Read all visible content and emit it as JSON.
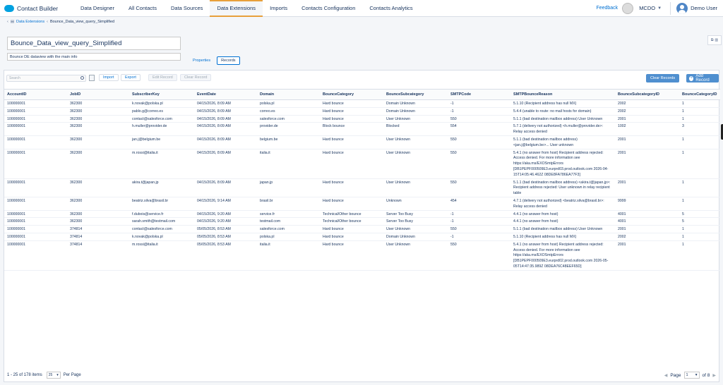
{
  "topbar": {
    "app_name": "Contact Builder",
    "nav": [
      "Data Designer",
      "All Contacts",
      "Data Sources",
      "Data Extensions",
      "Imports",
      "Contacts Configuration",
      "Contacts Analytics"
    ],
    "active_nav": "Data Extensions",
    "feedback": "Feedback",
    "business_unit": "MCDO",
    "user_name": "Demo User"
  },
  "breadcrumb": {
    "parent": "Data Extensions",
    "current": "Bounce_Data_view_query_Simplified"
  },
  "extension": {
    "name": "Bounce_Data_view_query_Simplified",
    "description": "Bounce DE dataview with the main info"
  },
  "tabs": [
    "Properties",
    "Records"
  ],
  "active_tab": "Records",
  "toolbar": {
    "search_placeholder": "Search",
    "import": "Import",
    "export": "Export",
    "edit_record": "Edit Record",
    "clear_record": "Clear Record",
    "clear_records": "Clear Records",
    "add_record": "Add Record"
  },
  "table": {
    "columns": [
      "AccountID",
      "JobID",
      "SubscriberKey",
      "EventDate",
      "Domain",
      "BounceCategory",
      "BounceSubcategory",
      "SMTPCode",
      "SMTPBounceReason",
      "BounceSubcategoryID",
      "BounceCategoryID"
    ],
    "rows": [
      [
        "100000001",
        "362300",
        "k.novak@polska.pl",
        "04/15/2026, 8:09 AM",
        "polska.pl",
        "Hard bounce",
        "Domain Unknown",
        "-1",
        "5.1.10 (Recipient address has null MX)",
        "2002",
        "1"
      ],
      [
        "100000001",
        "362300",
        "pablo.g@correo.es",
        "04/15/2026, 8:09 AM",
        "correo.es",
        "Hard bounce",
        "Domain Unknown",
        "-1",
        "5.4.4 (unable to route: no mail hosts for domain)",
        "2002",
        "1"
      ],
      [
        "100000001",
        "362300",
        "contact@salesforce.com",
        "04/15/2026, 8:09 AM",
        "salesforce.com",
        "Hard bounce",
        "User Unknown",
        "550",
        "5.1.1 (bad destination mailbox address) User Unknown",
        "2001",
        "1"
      ],
      [
        "100000001",
        "362300",
        "h.muller@provider.de",
        "04/15/2026, 8:09 AM",
        "provider.de",
        "Block bounce",
        "Blocked",
        "554",
        "5.7.1 (delivery not authorized) <h.muller@provider.de>: Relay access denied",
        "1002",
        "3"
      ],
      [
        "100000001",
        "362300",
        "jan.j@belgium.be",
        "04/15/2026, 8:09 AM",
        "belgium.be",
        "Hard bounce",
        "User Unknown",
        "550",
        "5.1.1 (bad destination mailbox address) <jan.j@belgium.be>... User unknown",
        "2001",
        "1"
      ],
      [
        "100000001",
        "362300",
        "m.rossi@italia.it",
        "04/15/2026, 8:09 AM",
        "italia.it",
        "Hard bounce",
        "User Unknown",
        "550",
        "5.4.1 (no answer from host) Recipient address rejected: Access denied. For more information see https://aka.ms/EXOSmtpErrors [DB1PEPF000509E3.eurprd03.prod.outlook.com 2026-04-15T14:05:46.462Z 08DE8FA786EA77F3]",
        "2001",
        "1"
      ],
      [
        "100000001",
        "362300",
        "akira.t@japan.jp",
        "04/15/2026, 8:09 AM",
        "japan.jp",
        "Hard bounce",
        "User Unknown",
        "550",
        "5.1.1 (bad destination mailbox address) <akira.t@japan.jp>: Recipient address rejected: User unknown in relay recipient table",
        "2001",
        "1"
      ],
      [
        "100000001",
        "362300",
        "beatriz.silva@brasil.br",
        "04/15/2026, 9:14 AM",
        "brasil.br",
        "Hard bounce",
        "Unknown",
        "454",
        "4.7.1 (delivery not authorized) <beatriz.silva@brasil.br>: Relay access denied",
        "9999",
        "1"
      ],
      [
        "100000001",
        "362300",
        "f.dubois@service.fr",
        "04/15/2026, 9:20 AM",
        "service.fr",
        "Technical/Other bounce",
        "Server Too Busy",
        "-1",
        "4.4.1 (no answer from host)",
        "4001",
        "5"
      ],
      [
        "100000001",
        "362300",
        "sarah.smith@testmail.com",
        "04/15/2026, 9:20 AM",
        "testmail.com",
        "Technical/Other bounce",
        "Server Too Busy",
        "-1",
        "4.4.1 (no answer from host)",
        "4001",
        "5"
      ],
      [
        "100000001",
        "374814",
        "contact@salesforce.com",
        "05/05/2026, 8:53 AM",
        "salesforce.com",
        "Hard bounce",
        "User Unknown",
        "550",
        "5.1.1 (bad destination mailbox address) User Unknown",
        "2001",
        "1"
      ],
      [
        "100000001",
        "374814",
        "k.novak@polska.pl",
        "05/05/2026, 8:53 AM",
        "polska.pl",
        "Hard bounce",
        "Domain Unknown",
        "-1",
        "5.1.10 (Recipient address has null MX)",
        "2002",
        "1"
      ],
      [
        "100000001",
        "374814",
        "m.rossi@italia.it",
        "05/05/2026, 8:53 AM",
        "italia.it",
        "Hard bounce",
        "User Unknown",
        "550",
        "5.4.1 (no answer from host) Recipient address rejected: Access denied. For more information see https://aka.ms/EXOSmtpErrors [DB1PEPF000509E3.eurprd02.prod.outlook.com 2026-05-05T14:47:35.989Z 08DEA76C48EEF65D]",
        "2001",
        "1"
      ]
    ]
  },
  "footer": {
    "count": "1 - 25 of 178 items",
    "per_page_value": "25",
    "per_page_label": "Per Page",
    "page_label": "Page",
    "page_value": "1",
    "page_total": "of 8"
  }
}
